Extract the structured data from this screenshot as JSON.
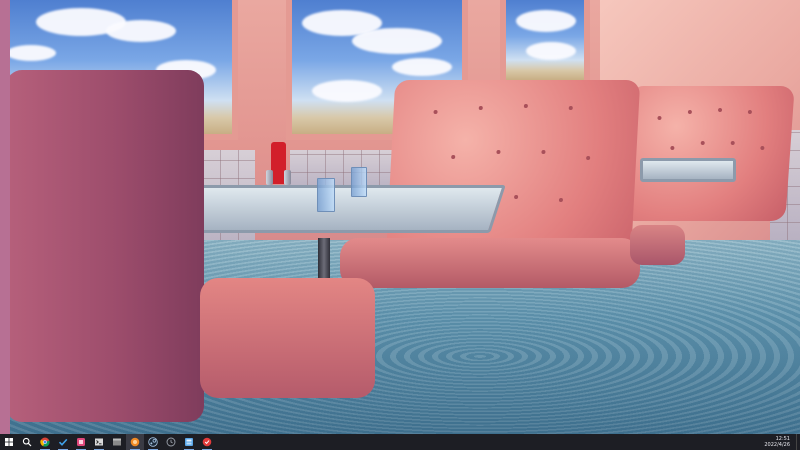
{
  "desktop": {
    "wallpaper": "flooded-diner-booths-wallpaper"
  },
  "taskbar": {
    "apps": [
      {
        "name": "start-button",
        "icon": "windows-logo-icon",
        "color": "#ffffff"
      },
      {
        "name": "search-button",
        "icon": "search-icon",
        "color": "#ffffff"
      },
      {
        "name": "chrome-app",
        "icon": "chrome-icon",
        "color": "#4caf50"
      },
      {
        "name": "checkmark-app",
        "icon": "checkmark-icon",
        "color": "#3fa1e8"
      },
      {
        "name": "pink-app",
        "icon": "pink-app-icon",
        "color": "#e0487c"
      },
      {
        "name": "terminal-app",
        "icon": "terminal-icon",
        "color": "#d9d9d9"
      },
      {
        "name": "gray-app",
        "icon": "gray-window-icon",
        "color": "#8a8a8a"
      },
      {
        "name": "orange-app",
        "icon": "orange-circle-icon",
        "color": "#f08a24"
      },
      {
        "name": "steam-app",
        "icon": "steam-icon",
        "color": "#a7c4e0"
      },
      {
        "name": "clock-app",
        "icon": "clock-icon",
        "color": "#9aa0aa"
      },
      {
        "name": "blue-app",
        "icon": "blue-app-icon",
        "color": "#5aa7e8"
      },
      {
        "name": "red-app",
        "icon": "red-app-icon",
        "color": "#e23b3b"
      }
    ],
    "clock": {
      "time": "12:51",
      "date": "2022/4/26"
    }
  }
}
